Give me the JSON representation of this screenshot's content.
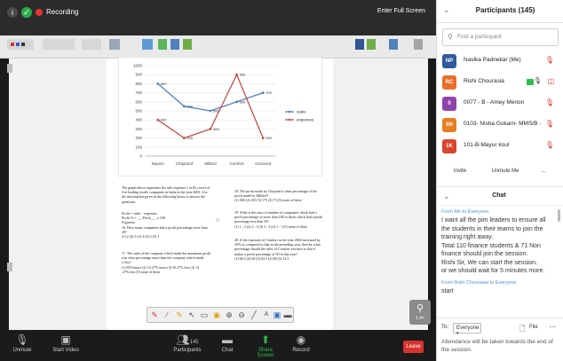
{
  "topbar": {
    "recording_label": "Recording",
    "fullscreen_label": "Enter Full Screen"
  },
  "annotation_labels": [
    "",
    "",
    "",
    "",
    "",
    "",
    "",
    "",
    ""
  ],
  "document": {
    "chart_data": {
      "type": "line",
      "categories": [
        "Nayem",
        "Chaytand",
        "Millard",
        "Comfort",
        "Crescent"
      ],
      "ylim": [
        0,
        1000
      ],
      "yticks": [
        0,
        100,
        200,
        300,
        400,
        500,
        600,
        700,
        800,
        900,
        1000
      ],
      "series": [
        {
          "name": "sales",
          "values": [
            800,
            550,
            500,
            600,
            700
          ],
          "color": "#4f81bd"
        },
        {
          "name": "expenses",
          "values": [
            400,
            200,
            300,
            900,
            200
          ],
          "color": "#c0504d"
        }
      ],
      "data_labels": {
        "sales": [
          "800",
          "550",
          "500",
          "600",
          "700"
        ],
        "expenses": [
          "400",
          "200",
          "300",
          "900",
          "200"
        ]
      }
    },
    "q_left_1": "The graph above represents the sale expenses ( in Rs crore) of\nfive leading textile companies in India in the year 2003. Use\nthe information given in the following boxes to answer the\nquestions.",
    "q_left_2": "Profit = sales − expenses\nProfit % = ___Profit___ x 100\n            Expenses\n16. How many companies had a profit percentage more than\n40?\n(1) 2  (2) 3  (3) 4  (4) 5  (5) 1",
    "q_left_3": "17. The sales of the company which made the maximum profit\nwas what percentage more than the company which made\na loss?\n(1) 69 %more  (2) 14.27% more  (3) 50.27% less  (4) 14\n.27% less  (5) none of these",
    "q_right_1": "18. The profit made by Chayand is what percentage of the\nprofit made by Millard?\n(1) 300  (2) 250  (3) 175  (4) 75  (5) none of these",
    "q_right_2": "19. What is the ratio of number of companies which had a\nprofit percentage of more than 100 to those which had a profit\npercentage less than 50?\n(1) 1 : 2  (2) 2 : 3  (3) 3 : 4  (4) 1 : 1  (5) none of these",
    "q_right_3": "20. If the expenses of Comfort in the year 2004 increased by\n20% as compared to that in the preceding year, then by what\npercentage should the sales of Comfort increase so that it\nmakes a profit percentage of 50 in that year?\n(1) 68.5  (2) 60  (3) 84.5  (4) 80  (5) 12.5"
  },
  "zoom": {
    "icon": "magnifier-plus-icon",
    "value": "1.4×"
  },
  "bottombar": {
    "unmute": "Unmute",
    "start_video": "Start Video",
    "participants": "Participants",
    "participants_count": "145",
    "chat": "Chat",
    "share_screen": "Share Screen",
    "record": "Record",
    "leave": "Leave"
  },
  "participants_panel": {
    "title": "Participants (145)",
    "search_placeholder": "Find a participant",
    "participants": [
      {
        "initials": "NP",
        "name": "Navika Padnekar (Me)",
        "color": "#2f5a9b"
      },
      {
        "initials": "RC",
        "name": "Rishi Chourasia",
        "color": "#e8702a"
      },
      {
        "initials": "0",
        "name": "0077 - B - Amey Menon",
        "color": "#8e44ad"
      },
      {
        "initials": "0N",
        "name": "0103- Nisha Gokarn- MMS/B -",
        "color": "#e67e22"
      },
      {
        "initials": "1K",
        "name": "101-B-Mayur koul",
        "color": "#d9452b"
      }
    ],
    "invite": "Invite",
    "unmute_me": "Unmute Me",
    "more": "..."
  },
  "chat": {
    "title": "Chat",
    "from_1": "From Me to Everyone:",
    "message_1": "I want all the pim leaders to ensure all the students in their teams to join the training right away.\nTotal 110 finance students & 71 Non finance  should join the session.\nRishi Sir, We can start the session.\nor we should wait for 5 minutes more.",
    "from_2": "From Rishi Chourasia to Everyone:",
    "message_2": "start",
    "to_label": "To:",
    "to_value": "Everyone",
    "file_label": "File",
    "input_text": "Attendance will be taken towards the end of the session."
  }
}
